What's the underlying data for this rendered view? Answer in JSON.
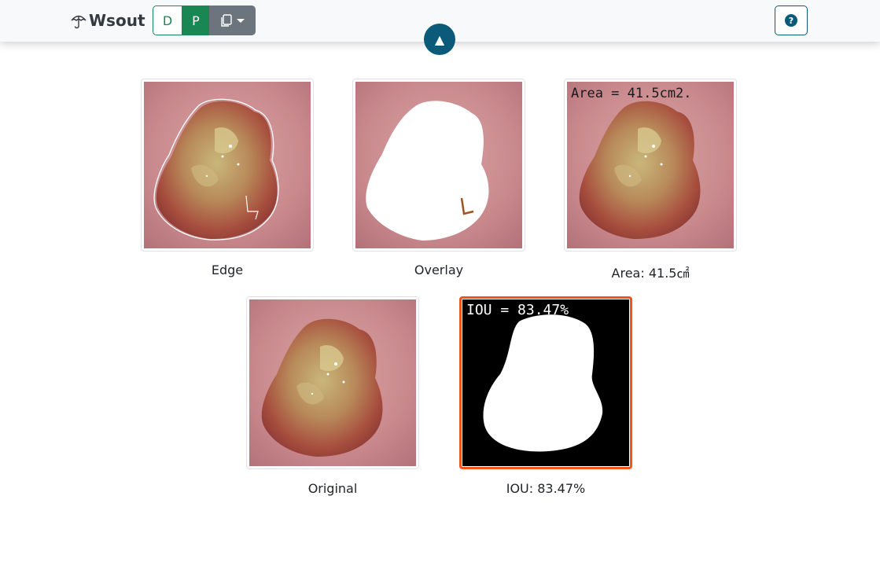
{
  "app": {
    "brand": "Wsout"
  },
  "toolbar": {
    "mode_d_label": "D",
    "mode_p_label": "P",
    "copy_icon": "copy-icon",
    "dropdown_icon": "caret-down-icon",
    "help_label": "?",
    "scroll_top_label": "▲"
  },
  "results": [
    {
      "id": "edge",
      "caption": "Edge",
      "image_text": ""
    },
    {
      "id": "overlay",
      "caption": "Overlay",
      "image_text": ""
    },
    {
      "id": "area",
      "caption": "Area: 41.5㎠",
      "image_text": "Area = 41.5cm2."
    },
    {
      "id": "original",
      "caption": "Original",
      "image_text": ""
    },
    {
      "id": "iou",
      "caption": "IOU: 83.47%",
      "image_text": "IOU = 83.47%",
      "highlight_color": "#f0541e"
    }
  ],
  "colors": {
    "success": "#198754",
    "secondary": "#6c757d",
    "primary_dark": "#0b5a7a",
    "highlight": "#f0541e"
  }
}
